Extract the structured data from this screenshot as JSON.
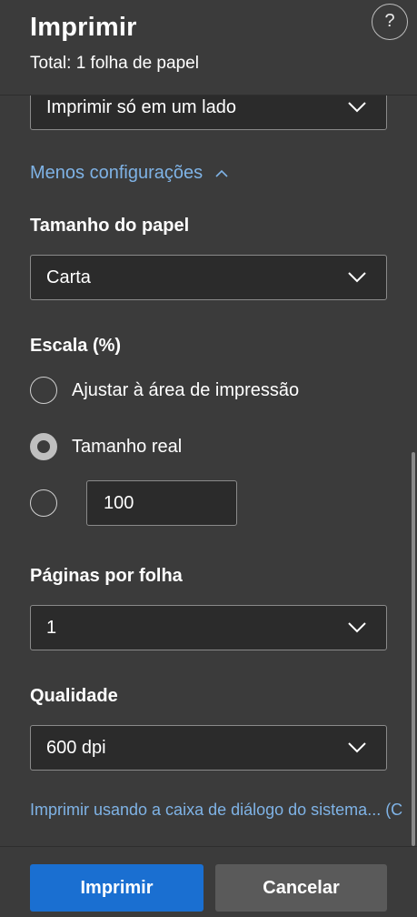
{
  "header": {
    "title": "Imprimir",
    "subtitle": "Total: 1 folha de papel",
    "help_symbol": "?"
  },
  "sides": {
    "value": "Imprimir só em um lado"
  },
  "toggle_settings": {
    "label": "Menos configurações",
    "icon": "chevron-up-icon"
  },
  "paper_size": {
    "label": "Tamanho do papel",
    "value": "Carta"
  },
  "scale": {
    "label": "Escala (%)",
    "options": [
      {
        "label": "Ajustar à área de impressão",
        "selected": false
      },
      {
        "label": "Tamanho real",
        "selected": true
      },
      {
        "label": "",
        "selected": false
      }
    ],
    "custom_value": "100"
  },
  "pages_per_sheet": {
    "label": "Páginas por folha",
    "value": "1"
  },
  "quality": {
    "label": "Qualidade",
    "value": "600 dpi"
  },
  "system_dialog_link": "Imprimir usando a caixa de diálogo do sistema... (C",
  "footer": {
    "print_label": "Imprimir",
    "cancel_label": "Cancelar"
  },
  "colors": {
    "background": "#3b3b3b",
    "field_bg": "#2b2b2b",
    "accent": "#1a6fd1",
    "link": "#7fb3e6"
  }
}
